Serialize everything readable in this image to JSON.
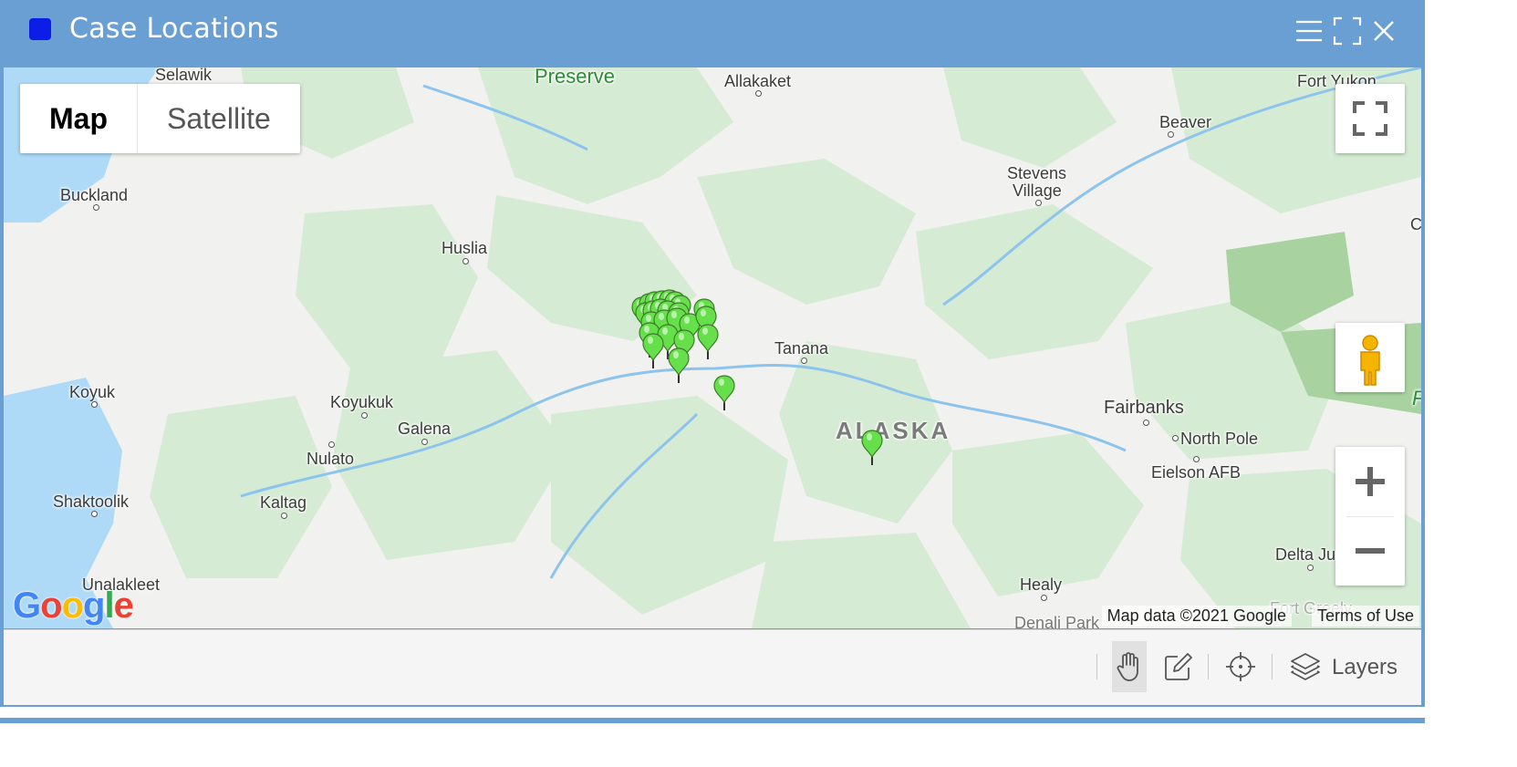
{
  "window": {
    "title": "Case Locations",
    "accent_color": "#6a9fd4",
    "title_square_color": "#0b1de6",
    "controls": [
      "menu-icon",
      "maximize-icon",
      "close-icon"
    ]
  },
  "map": {
    "type_controls": {
      "map_label": "Map",
      "satellite_label": "Satellite",
      "selected": "Map"
    },
    "places": {
      "selawik": "Selawik",
      "preserve": "Preserve",
      "allakaket": "Allakaket",
      "fort_yukon": "Fort Yukon",
      "beaver": "Beaver",
      "stevens_village_1": "Stevens",
      "stevens_village_2": "Village",
      "buckland": "Buckland",
      "huslia": "Huslia",
      "tanana": "Tanana",
      "koyuk": "Koyuk",
      "koyukuk": "Koyukuk",
      "galena": "Galena",
      "nulato": "Nulato",
      "alaska": "ALASKA",
      "fairbanks": "Fairbanks",
      "north_pole": "North Pole",
      "eielson": "Eielson AFB",
      "shaktoolik": "Shaktoolik",
      "kaltag": "Kaltag",
      "unalakleet": "Unalakleet",
      "healy": "Healy",
      "delta_junction": "Delta Juncti",
      "denali_park": "Denali Park",
      "fort_greely": "Fort Greely",
      "edge_c": "C",
      "edge_f": "F"
    },
    "logo": "Google",
    "attribution": "Map data ©2021 Google",
    "terms": "Terms of Use",
    "marker_color": "#66e04a",
    "marker_count": 25
  },
  "toolbar": {
    "tools": [
      "pan-hand-icon",
      "edit-pencil-icon",
      "crosshair-icon",
      "layers-icon"
    ],
    "active_tool": "pan-hand-icon",
    "layers_label": "Layers"
  }
}
